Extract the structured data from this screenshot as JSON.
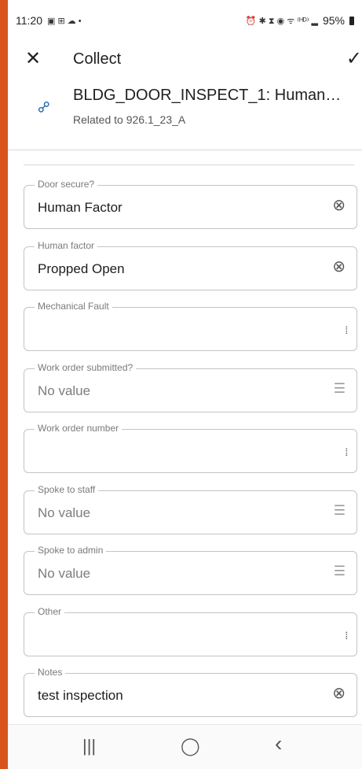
{
  "status_bar": {
    "time": "11:20",
    "left_icons": "▣ ⊞ ☁ •",
    "right_icons": "⏰ ✱ ⧗ ◉ ᯤ ⁽ᴴᴰ⁾ ▂",
    "battery": "95%"
  },
  "app_bar": {
    "close_icon": "✕",
    "title": "Collect",
    "check_icon": "✓"
  },
  "record": {
    "link_icon": "⚯",
    "title": "BLDG_DOOR_INSPECT_1: Human…",
    "subtitle": "Related to 926.1_23_A"
  },
  "fields": [
    {
      "label": "Door secure?",
      "value": "Human Factor",
      "empty": false,
      "icon": "clear-icon",
      "glyph": "⊗"
    },
    {
      "label": "Human factor",
      "value": "Propped Open",
      "empty": false,
      "icon": "clear-icon",
      "glyph": "⊗"
    },
    {
      "label": "Mechanical Fault",
      "value": "",
      "empty": true,
      "icon": "barcode-scan-icon",
      "glyph": "⦙⦙⦙"
    },
    {
      "label": "Work order submitted?",
      "value": "No value",
      "empty": true,
      "icon": "list-icon",
      "glyph": "☰"
    },
    {
      "label": "Work order number",
      "value": "",
      "empty": true,
      "icon": "barcode-scan-icon",
      "glyph": "⦙⦙⦙"
    },
    {
      "label": "Spoke to staff",
      "value": "No value",
      "empty": true,
      "icon": "list-icon",
      "glyph": "☰"
    },
    {
      "label": "Spoke to admin",
      "value": "No value",
      "empty": true,
      "icon": "list-icon",
      "glyph": "☰"
    },
    {
      "label": "Other",
      "value": "",
      "empty": true,
      "icon": "barcode-scan-icon",
      "glyph": "⦙⦙⦙"
    },
    {
      "label": "Notes",
      "value": "test inspection",
      "empty": false,
      "icon": "clear-icon",
      "glyph": "⊗"
    }
  ],
  "nav_bar": {
    "recents_icon": "|||",
    "home_icon": "◯",
    "back_icon": "‹"
  },
  "colors": {
    "accent": "#2a6fb4",
    "frame": "#d9541c"
  }
}
